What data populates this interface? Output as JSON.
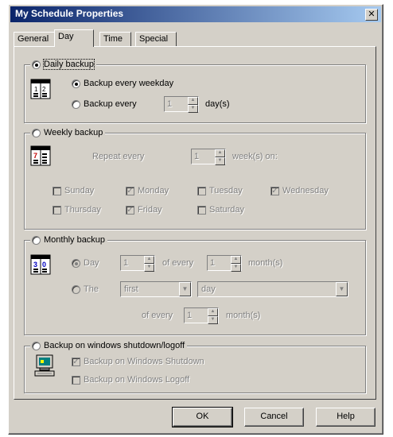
{
  "window": {
    "title": "My Schedule Properties",
    "close_glyph": "✕"
  },
  "tabs": [
    {
      "label": "General"
    },
    {
      "label": "Day"
    },
    {
      "label": "Time"
    },
    {
      "label": "Special"
    }
  ],
  "daily": {
    "title": "Daily backup",
    "opt_weekday": "Backup every weekday",
    "opt_every": "Backup every",
    "every_value": "1",
    "unit": "day(s)",
    "icon": "calendar-1-12-icon",
    "icon_text": "1|2"
  },
  "weekly": {
    "title": "Weekly backup",
    "repeat_label": "Repeat every",
    "repeat_value": "1",
    "unit": "week(s) on:",
    "icon": "calendar-7-icon",
    "icon_text": "7|",
    "days": [
      {
        "label": "Sunday",
        "checked": false
      },
      {
        "label": "Monday",
        "checked": true
      },
      {
        "label": "Tuesday",
        "checked": false
      },
      {
        "label": "Wednesday",
        "checked": true
      },
      {
        "label": "Thursday",
        "checked": false
      },
      {
        "label": "Friday",
        "checked": true
      },
      {
        "label": "Saturday",
        "checked": false
      }
    ]
  },
  "monthly": {
    "title": "Monthly backup",
    "opt_day": "Day",
    "day_value": "1",
    "of_every": "of every",
    "day_month_value": "1",
    "months_unit": "month(s)",
    "opt_the": "The",
    "the_first": "first",
    "the_day": "day",
    "of_every_2": "of every",
    "the_month_value": "1",
    "months_unit_2": "month(s)",
    "icon": "calendar-30-icon",
    "icon_text": "3|0"
  },
  "shutdown": {
    "title": "Backup on windows shutdown/logoff",
    "opt_shutdown": "Backup on Windows Shutdown",
    "opt_logoff": "Backup on Windows Logoff",
    "icon": "computer-icon"
  },
  "buttons": {
    "ok": "OK",
    "cancel": "Cancel",
    "help": "Help"
  },
  "colors": {
    "face": "#d4d0c8",
    "title_start": "#0a246a",
    "title_end": "#a6caf0"
  }
}
